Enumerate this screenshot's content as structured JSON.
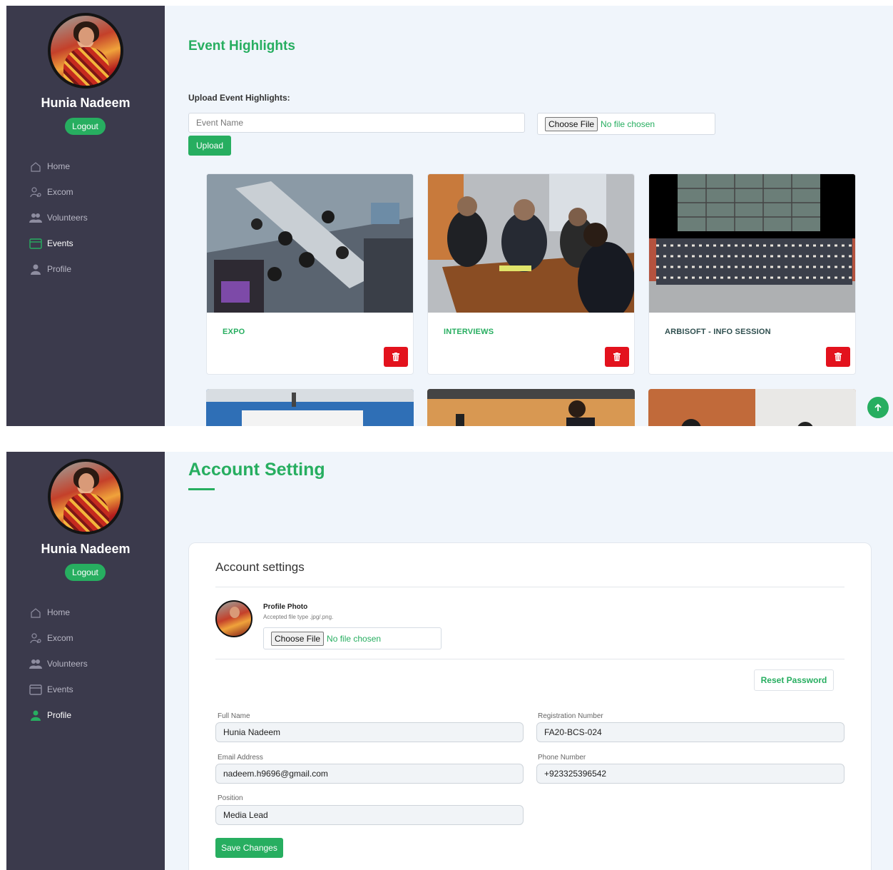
{
  "user": {
    "name": "Hunia Nadeem",
    "logout_label": "Logout"
  },
  "nav": [
    {
      "label": "Home",
      "icon": "home-icon"
    },
    {
      "label": "Excom",
      "icon": "user-gear-icon"
    },
    {
      "label": "Volunteers",
      "icon": "users-icon"
    },
    {
      "label": "Events",
      "icon": "calendar-icon"
    },
    {
      "label": "Profile",
      "icon": "user-icon"
    }
  ],
  "events_page": {
    "title": "Event Highlights",
    "upload_label": "Upload Event Highlights:",
    "event_name_placeholder": "Event Name",
    "choose_file_label": "Choose File",
    "file_status": "No file chosen",
    "upload_button": "Upload",
    "active_nav": "Events",
    "cards": [
      {
        "title": "EXPO",
        "title_color": "#27ae60"
      },
      {
        "title": "INTERVIEWS",
        "title_color": "#27ae60"
      },
      {
        "title": "ARBISOFT - INFO SESSION",
        "title_color": "#2f4f4f"
      }
    ]
  },
  "account_page": {
    "title": "Account Setting",
    "active_nav": "Profile",
    "card_title": "Account settings",
    "profile_photo_label": "Profile Photo",
    "accepted_types": "Accepted file type .jpg/.png.",
    "choose_file_label": "Choose File",
    "file_status": "No file chosen",
    "reset_password": "Reset Password",
    "fields": {
      "full_name": {
        "label": "Full Name",
        "value": "Hunia Nadeem"
      },
      "registration_number": {
        "label": "Registration Number",
        "value": "FA20-BCS-024"
      },
      "email": {
        "label": "Email Address",
        "value": "nadeem.h9696@gmail.com"
      },
      "phone": {
        "label": "Phone Number",
        "value": "+923325396542"
      },
      "position": {
        "label": "Position",
        "value": "Media Lead"
      }
    },
    "save_button": "Save Changes"
  },
  "colors": {
    "accent": "#27ae60",
    "sidebar": "#3b3a4c",
    "danger": "#e3121d",
    "background": "#f0f5fb"
  }
}
